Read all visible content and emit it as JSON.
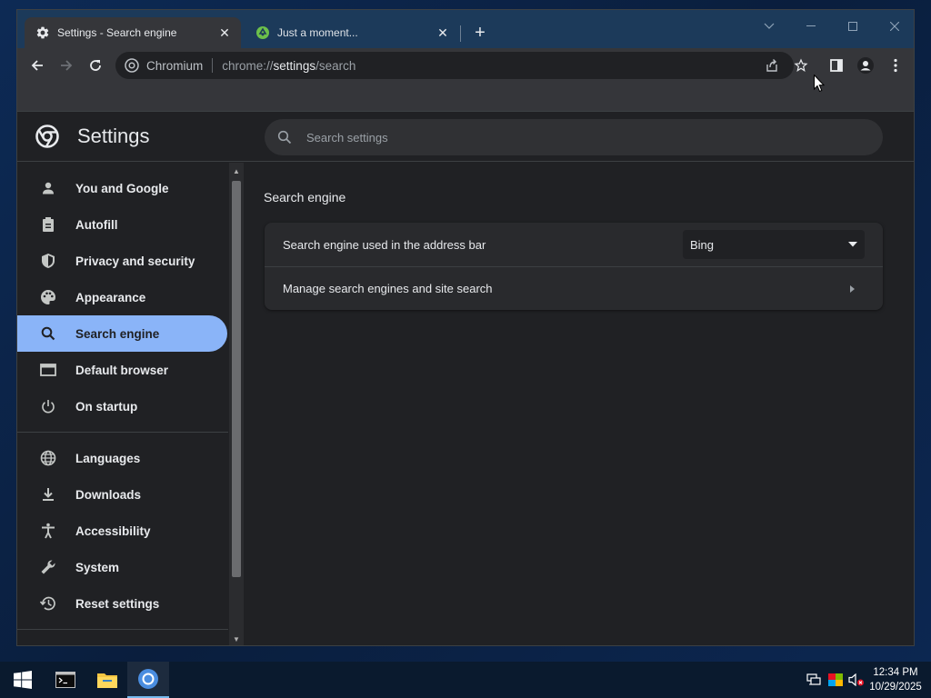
{
  "browser": {
    "tabs": [
      {
        "title": "Settings - Search engine",
        "icon": "gear-icon",
        "active": true
      },
      {
        "title": "Just a moment...",
        "icon": "recycle-icon",
        "active": false
      }
    ],
    "address_bar": {
      "site_name": "Chromium",
      "url_scheme": "chrome://",
      "url_host": "settings",
      "url_path": "/search"
    }
  },
  "settings": {
    "title": "Settings",
    "search_placeholder": "Search settings",
    "nav": [
      {
        "label": "You and Google",
        "icon": "person-icon",
        "selected": false
      },
      {
        "label": "Autofill",
        "icon": "clipboard-icon",
        "selected": false
      },
      {
        "label": "Privacy and security",
        "icon": "shield-icon",
        "selected": false
      },
      {
        "label": "Appearance",
        "icon": "palette-icon",
        "selected": false
      },
      {
        "label": "Search engine",
        "icon": "search-icon",
        "selected": true
      },
      {
        "label": "Default browser",
        "icon": "browser-window-icon",
        "selected": false
      },
      {
        "label": "On startup",
        "icon": "power-icon",
        "selected": false
      },
      {
        "label": "Languages",
        "icon": "globe-icon",
        "selected": false
      },
      {
        "label": "Downloads",
        "icon": "download-icon",
        "selected": false
      },
      {
        "label": "Accessibility",
        "icon": "accessibility-icon",
        "selected": false
      },
      {
        "label": "System",
        "icon": "wrench-icon",
        "selected": false
      },
      {
        "label": "Reset settings",
        "icon": "history-icon",
        "selected": false
      }
    ],
    "main": {
      "section_title": "Search engine",
      "rows": [
        {
          "label": "Search engine used in the address bar",
          "value": "Bing"
        },
        {
          "label": "Manage search engines and site search"
        }
      ]
    }
  },
  "taskbar": {
    "time": "12:34 PM",
    "date": "10/29/2025"
  },
  "colors": {
    "accent": "#8ab4f8",
    "background": "#202124",
    "card": "#292a2d"
  }
}
